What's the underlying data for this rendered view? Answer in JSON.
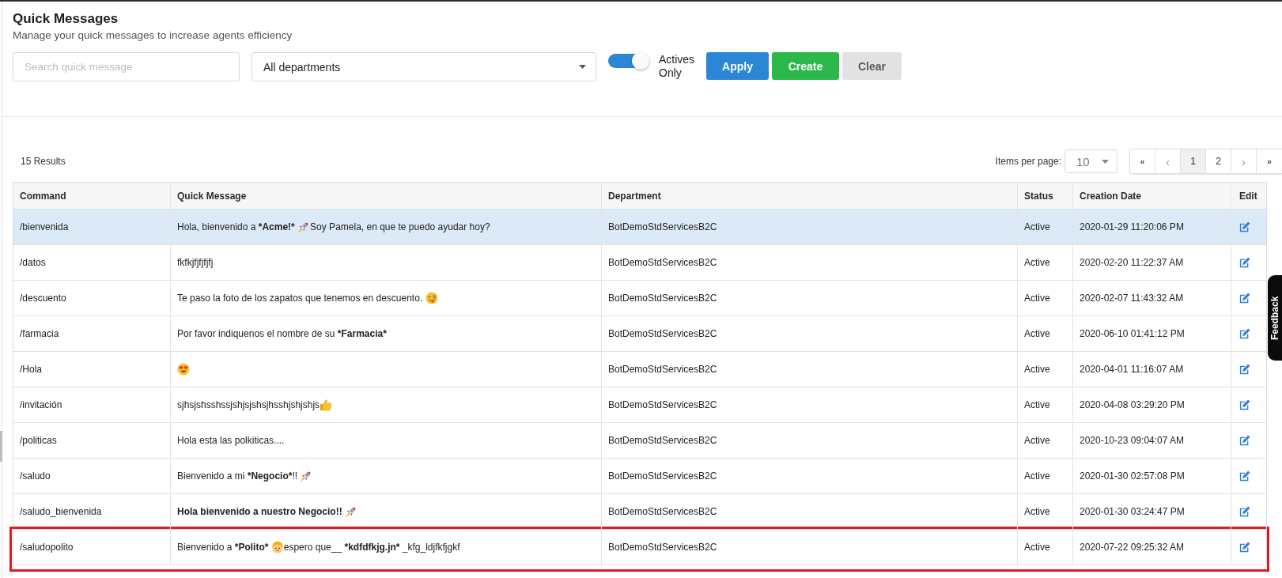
{
  "header": {
    "title": "Quick Messages",
    "subtitle": "Manage your quick messages to increase agents efficiency"
  },
  "filters": {
    "search": {
      "placeholder": "Search quick message"
    },
    "department": {
      "value": "All departments"
    },
    "actives_only": {
      "label": "Actives Only",
      "on": true
    },
    "buttons": [
      {
        "kind": "apply",
        "label": "Apply"
      },
      {
        "kind": "create",
        "label": "Create"
      },
      {
        "kind": "clear",
        "label": "Clear"
      }
    ]
  },
  "results": {
    "count": "15 Results",
    "items_per_page": {
      "label": "Items per page:",
      "value": "10"
    },
    "pagination": [
      {
        "kind": "first",
        "label": "«",
        "selected": false
      },
      {
        "kind": "prev",
        "label": "‹",
        "selected": false
      },
      {
        "kind": "page",
        "label": "1",
        "selected": true
      },
      {
        "kind": "page",
        "label": "2",
        "selected": false
      },
      {
        "kind": "next",
        "label": "›",
        "selected": false
      },
      {
        "kind": "last",
        "label": "»",
        "selected": false
      }
    ]
  },
  "table": {
    "columns": [
      "Command",
      "Quick Message",
      "Department",
      "Status",
      "Creation Date",
      "Edit"
    ],
    "rows": [
      {
        "command": "/bienvenida",
        "message": [
          {
            "kind": "text",
            "text": "Hola, bienvenido a ",
            "bold": false
          },
          {
            "kind": "text",
            "text": "*Acme!* ",
            "bold": true
          },
          {
            "kind": "rocket"
          },
          {
            "kind": "text",
            "text": "Soy Pamela, en que te puedo ayudar hoy?",
            "bold": false
          }
        ],
        "department": "BotDemoStdServicesB2C",
        "status": "Active",
        "created": "2020-01-29 11:20:06 PM",
        "selected": true,
        "highlighted": false
      },
      {
        "command": "/datos",
        "message": [
          {
            "kind": "text",
            "text": "fkfkjfjfjfjfj",
            "bold": false
          }
        ],
        "department": "BotDemoStdServicesB2C",
        "status": "Active",
        "created": "2020-02-20 11:22:37 AM",
        "selected": false,
        "highlighted": false
      },
      {
        "command": "/descuento",
        "message": [
          {
            "kind": "text",
            "text": "Te paso la foto de los zapatos que tenemos en descuento. ",
            "bold": false
          },
          {
            "kind": "wink"
          }
        ],
        "department": "BotDemoStdServicesB2C",
        "status": "Active",
        "created": "2020-02-07 11:43:32 AM",
        "selected": false,
        "highlighted": false
      },
      {
        "command": "/farmacia",
        "message": [
          {
            "kind": "text",
            "text": "Por favor indiquenos el nombre de su ",
            "bold": false
          },
          {
            "kind": "text",
            "text": "*Farmacia*",
            "bold": true
          }
        ],
        "department": "BotDemoStdServicesB2C",
        "status": "Active",
        "created": "2020-06-10 01:41:12 PM",
        "selected": false,
        "highlighted": false
      },
      {
        "command": "/Hola",
        "message": [
          {
            "kind": "hearteyes"
          }
        ],
        "department": "BotDemoStdServicesB2C",
        "status": "Active",
        "created": "2020-04-01 11:16:07 AM",
        "selected": false,
        "highlighted": false
      },
      {
        "command": "/invitación",
        "message": [
          {
            "kind": "text",
            "text": "sjhsjshsshssjshjsjshsjhsshjshjshjs",
            "bold": false
          },
          {
            "kind": "thumbsup"
          }
        ],
        "department": "BotDemoStdServicesB2C",
        "status": "Active",
        "created": "2020-04-08 03:29:20 PM",
        "selected": false,
        "highlighted": false
      },
      {
        "command": "/politicas",
        "message": [
          {
            "kind": "text",
            "text": "Hola esta las polkiticas....",
            "bold": false
          }
        ],
        "department": "BotDemoStdServicesB2C",
        "status": "Active",
        "created": "2020-10-23 09:04:07 AM",
        "selected": false,
        "highlighted": false
      },
      {
        "command": "/saludo",
        "message": [
          {
            "kind": "text",
            "text": "Bienvenido a mi ",
            "bold": false
          },
          {
            "kind": "text",
            "text": "*Negocio*",
            "bold": true
          },
          {
            "kind": "text",
            "text": "!! ",
            "bold": false
          },
          {
            "kind": "rocket"
          }
        ],
        "department": "BotDemoStdServicesB2C",
        "status": "Active",
        "created": "2020-01-30 02:57:08 PM",
        "selected": false,
        "highlighted": false
      },
      {
        "command": "/saludo_bienvenida",
        "message": [
          {
            "kind": "text",
            "text": "Hola bienvenido a nuestro Negocio!! ",
            "bold": true
          },
          {
            "kind": "rocket"
          }
        ],
        "department": "BotDemoStdServicesB2C",
        "status": "Active",
        "created": "2020-01-30 03:24:47 PM",
        "selected": false,
        "highlighted": false
      },
      {
        "command": "/saludopolito",
        "message": [
          {
            "kind": "text",
            "text": "Bienvenido a ",
            "bold": false
          },
          {
            "kind": "text",
            "text": "*Polito* ",
            "bold": true
          },
          {
            "kind": "blondface"
          },
          {
            "kind": "text",
            "text": "espero que__ ",
            "bold": false
          },
          {
            "kind": "text",
            "text": "*kdfdfkjg.jn*",
            "bold": true
          },
          {
            "kind": "text",
            "text": " _kfg_ldjfkfjgkf",
            "bold": false
          }
        ],
        "department": "BotDemoStdServicesB2C",
        "status": "Active",
        "created": "2020-07-22 09:25:32 AM",
        "selected": false,
        "highlighted": true
      }
    ]
  },
  "feedback_tab": {
    "label": "Feedback"
  }
}
